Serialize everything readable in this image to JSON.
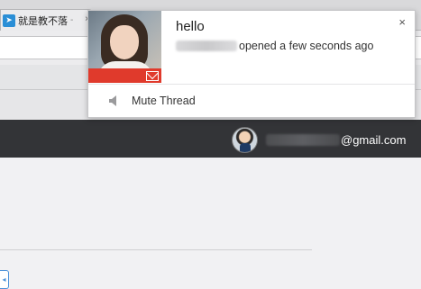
{
  "browser": {
    "tab": {
      "title": "就是教不落",
      "separator": "-",
      "close_glyph": "×",
      "favicon": "telegram-plane-icon"
    }
  },
  "notification": {
    "title": "hello",
    "subtitle_suffix": "opened a few seconds ago",
    "close_glyph": "×",
    "mute_label": "Mute Thread",
    "accent_color": "#e03a2c"
  },
  "account": {
    "email_domain": "@gmail.com"
  },
  "colors": {
    "appbar": "#333437"
  }
}
